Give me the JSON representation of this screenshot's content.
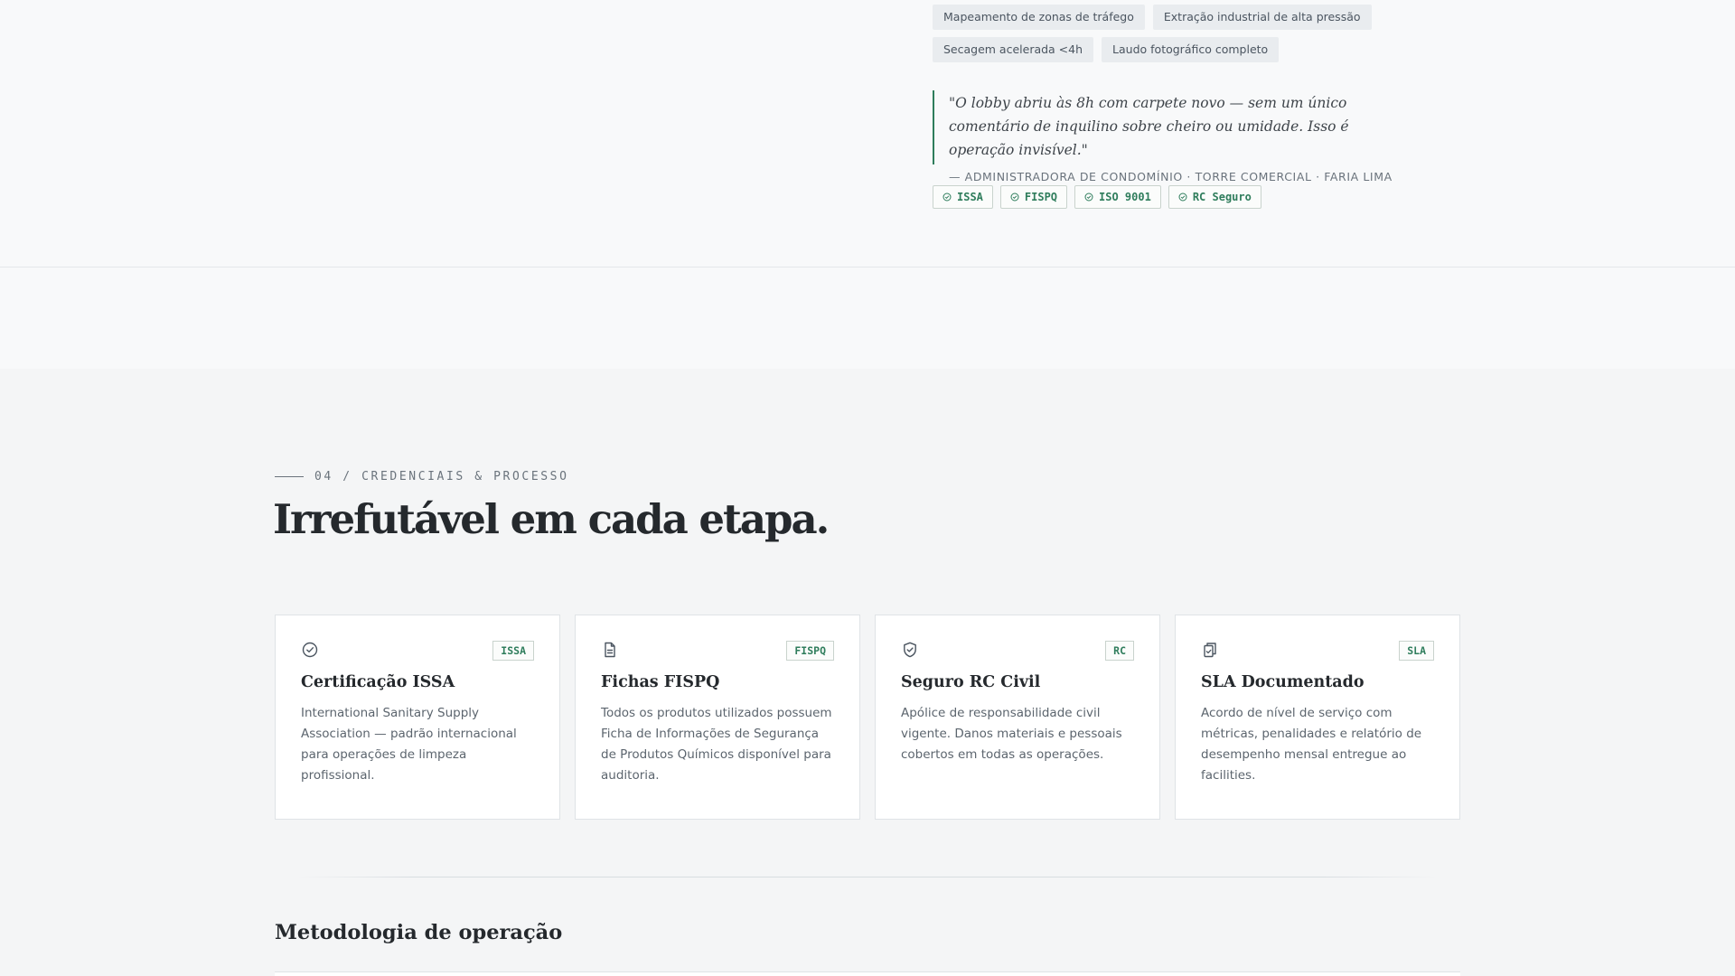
{
  "features": {
    "chips": [
      [
        "Mapeamento de zonas de tráfego",
        "Extração industrial de alta pressão"
      ],
      [
        "Secagem acelerada <4h",
        "Laudo fotográfico completo"
      ]
    ]
  },
  "testimonial": {
    "quote": "\"O lobby abriu às 8h com carpete novo — sem um único comentário de inquilino sobre cheiro ou umidade. Isso é operação invisível.\"",
    "author": "— ADMINISTRADORA DE CONDOMÍNIO · TORRE COMERCIAL · FARIA LIMA"
  },
  "certifications": [
    "ISSA",
    "FISPQ",
    "ISO 9001",
    "RC Seguro"
  ],
  "section": {
    "eyebrow": "04 / CREDENCIAIS & PROCESSO",
    "headline": "Irrefutável em cada etapa."
  },
  "cards": [
    {
      "icon": "check-circle-icon",
      "tag": "ISSA",
      "title": "Certificação ISSA",
      "description": "International Sanitary Supply Association — padrão internacional para operações de limpeza profissional."
    },
    {
      "icon": "document-icon",
      "tag": "FISPQ",
      "title": "Fichas FISPQ",
      "description": "Todos os produtos utilizados possuem Ficha de Informações de Segurança de Produtos Químicos disponível para auditoria."
    },
    {
      "icon": "shield-check-icon",
      "tag": "RC",
      "title": "Seguro RC Civil",
      "description": "Apólice de responsabilidade civil vigente. Danos materiais e pessoais cobertos em todas as operações."
    },
    {
      "icon": "clipboard-copy-icon",
      "tag": "SLA",
      "title": "SLA Documentado",
      "description": "Acordo de nível de serviço com métricas, penalidades e relatório de desempenho mensal entregue ao facilities."
    }
  ],
  "methodology": {
    "title": "Metodologia de operação"
  },
  "colors": {
    "accent": "#2f7d5c",
    "background": "#f4f5f6",
    "chip_bg": "#e9ecef"
  }
}
